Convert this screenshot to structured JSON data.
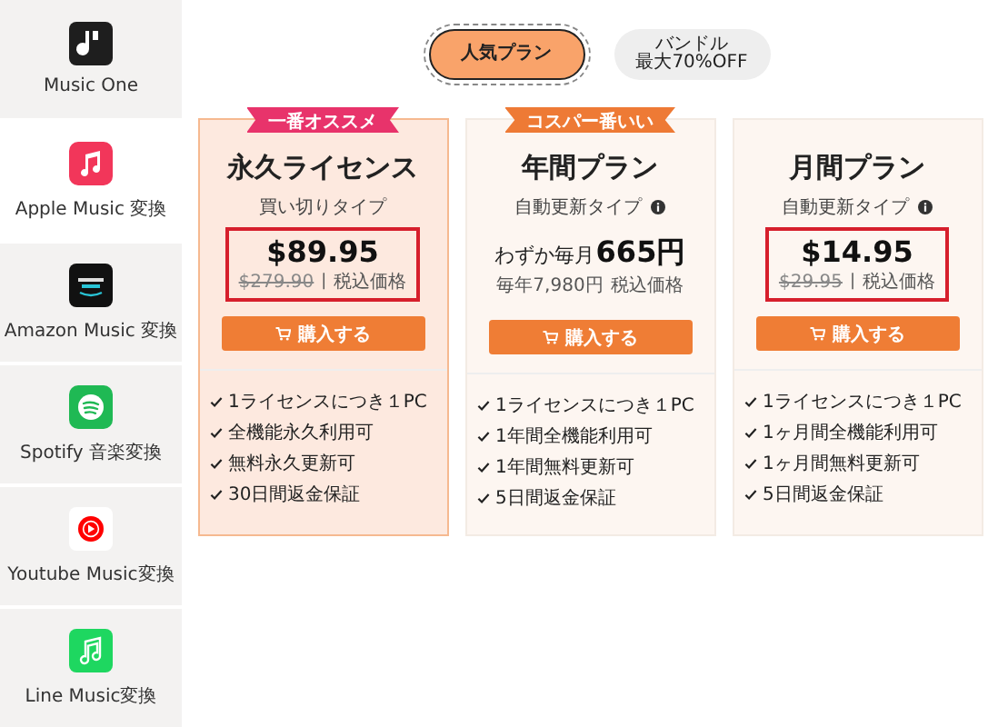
{
  "sidebar": {
    "items": [
      {
        "label": "Music One",
        "kind": "musicone",
        "selected": false
      },
      {
        "label": "Apple Music 変換",
        "kind": "apple",
        "selected": true
      },
      {
        "label": "Amazon Music 変換",
        "kind": "amazon",
        "selected": false
      },
      {
        "label": "Spotify 音楽変換",
        "kind": "spotify",
        "selected": false
      },
      {
        "label": "Youtube Music変換",
        "kind": "youtube",
        "selected": false
      },
      {
        "label": "Line Music変換",
        "kind": "line",
        "selected": false
      }
    ]
  },
  "tabs": [
    {
      "lines": [
        "人気プラン"
      ],
      "selected": true
    },
    {
      "lines": [
        "バンドル",
        "最大70%OFF"
      ],
      "selected": false
    }
  ],
  "plans": [
    {
      "badge": "一番オススメ",
      "color": "#e8336b",
      "title": "永久ライセンス",
      "subtitle": "買い切りタイプ",
      "info": false,
      "kind": "usd",
      "price": "$89.95",
      "old_price": "$279.90",
      "separator": "|",
      "tax": "税込価格",
      "highlighted": true,
      "selected": true,
      "button": "購入する",
      "features": [
        "1ライセンスにつき１PC",
        "全機能永久利用可",
        "無料永久更新可",
        "30日間返金保証"
      ]
    },
    {
      "badge": "コスパー番いい",
      "color": "#ee7a35",
      "title": "年間プラン",
      "subtitle": "自動更新タイプ",
      "info": true,
      "kind": "jpy",
      "prefix": "わずか毎月",
      "price": "665円",
      "old_price": "毎年7,980円",
      "tax": "税込価格",
      "highlighted": false,
      "selected": false,
      "button": "購入する",
      "features": [
        "1ライセンスにつき１PC",
        "1年間全機能利用可",
        "1年間無料更新可",
        "5日間返金保証"
      ]
    },
    {
      "title": "月間プラン",
      "subtitle": "自動更新タイプ",
      "info": true,
      "kind": "usd",
      "price": "$14.95",
      "old_price": "$29.95",
      "separator": "|",
      "tax": "税込価格",
      "highlighted": true,
      "selected": false,
      "button": "購入する",
      "features": [
        "1ライセンスにつき１PC",
        "1ヶ月間全機能利用可",
        "1ヶ月間無料更新可",
        "5日間返金保証"
      ]
    }
  ]
}
